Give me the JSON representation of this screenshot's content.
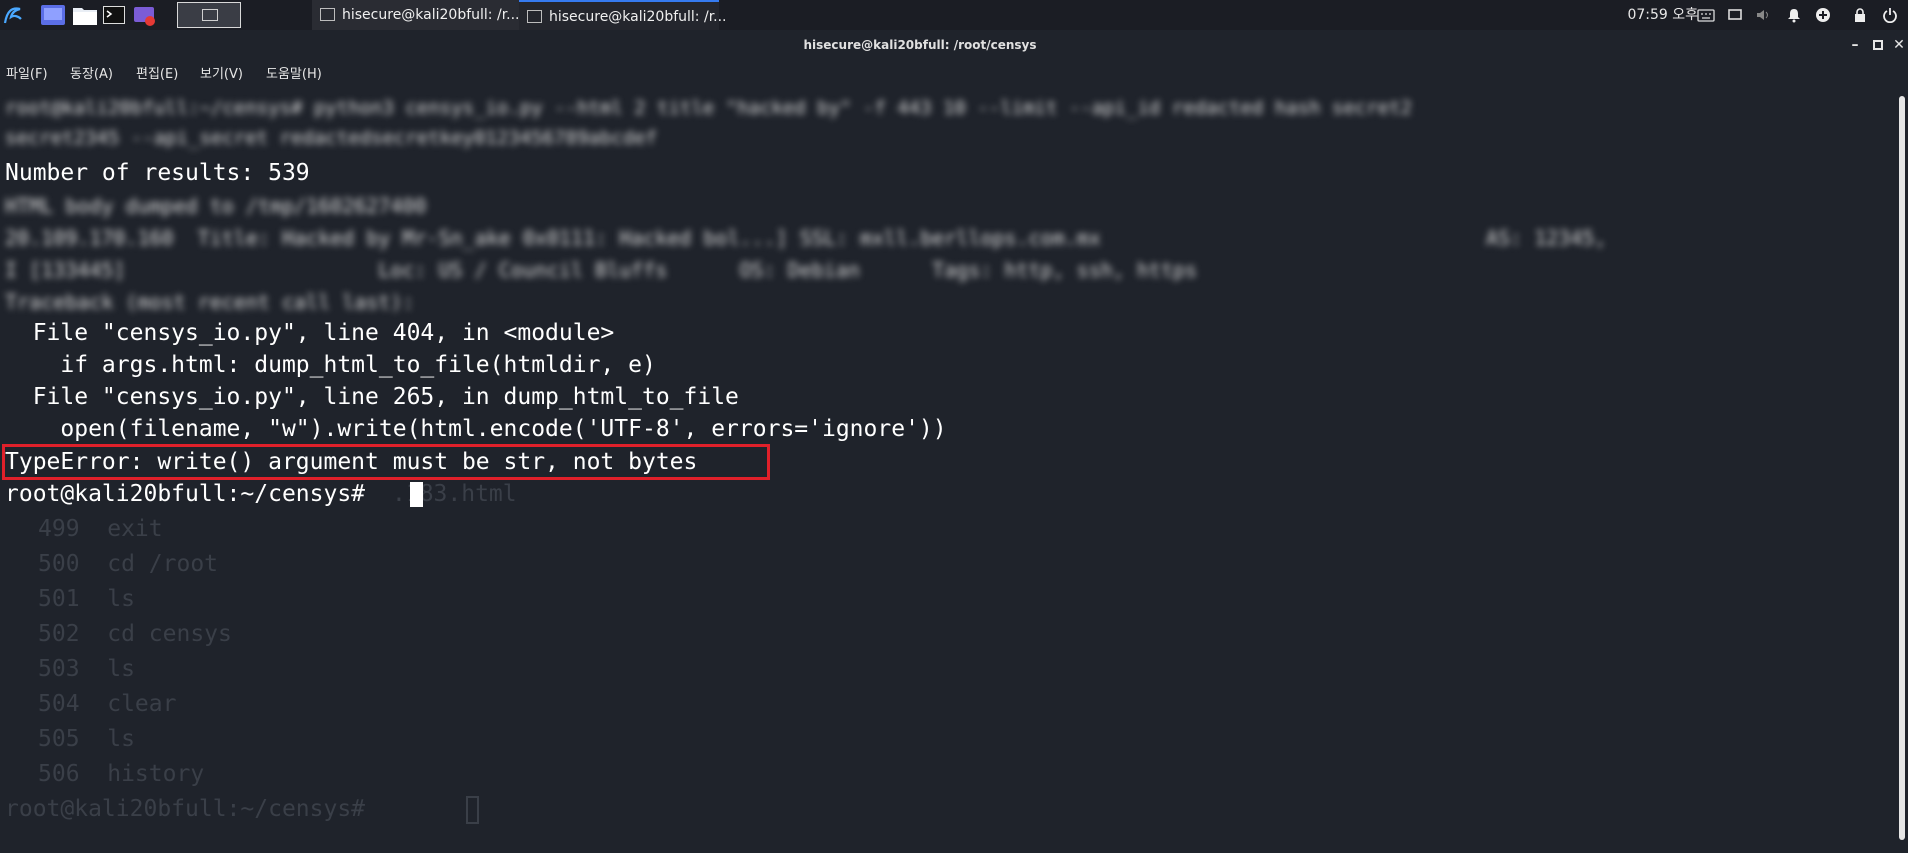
{
  "taskbar": {
    "tasks": [
      {
        "label": "hisecure@kali20bfull: /r..."
      },
      {
        "label": "hisecure@kali20bfull: /r..."
      }
    ],
    "clock": "07:59 오후"
  },
  "window": {
    "title": "hisecure@kali20bfull: /root/censys",
    "menu": [
      "파일(F)",
      "동장(A)",
      "편집(E)",
      "보기(V)",
      "도움말(H)"
    ]
  },
  "terminal": {
    "blurred_top_1": "root@kali20bfull:~/censys# python3 censys_io.py --html 2 title \"hacked by\" -f 443 10 --limit --api_id redacted hash secret2",
    "blurred_top_2": "secret2345 --api_secret redactedsecretkey0123456789abcdef",
    "results": "Number of results: 539",
    "blurred_1": "HTML body dumped to /tmp/1602627400",
    "blurred_2": "20.109.170.160  Title: Hacked by Mr-Sn_ake 0x0111: Hacked bol...] SSL: mxll.berllops.com.mx                                AS: 12345,",
    "blurred_3": "I [133445]                     Loc: US / Council Bluffs      OS: Debian      Tags: http, ssh, https",
    "blurred_4": "Traceback (most recent call last):",
    "tb_1": "  File \"censys_io.py\", line 404, in <module>",
    "tb_2": "    if args.html: dump_html_to_file(htmldir, e)",
    "tb_3": "  File \"censys_io.py\", line 265, in dump_html_to_file",
    "tb_4": "    open(filename, \"w\").write(html.encode('UTF-8', errors='ignore'))",
    "error": "TypeError: write() argument must be str, not bytes",
    "prompt": "root@kali20bfull:~/censys# ",
    "ghost_partial": ".183.html",
    "ghost_history": [
      "499  exit",
      "500  cd /root",
      "501  ls",
      "502  cd censys",
      "503  ls",
      "504  clear",
      "505  ls",
      "506  history"
    ],
    "ghost_prompt": "root@kali20bfull:~/censys# "
  },
  "colors": {
    "terminal_bg": "#1f232b",
    "highlight_box": "#e0202a",
    "accent": "#367bf0"
  }
}
